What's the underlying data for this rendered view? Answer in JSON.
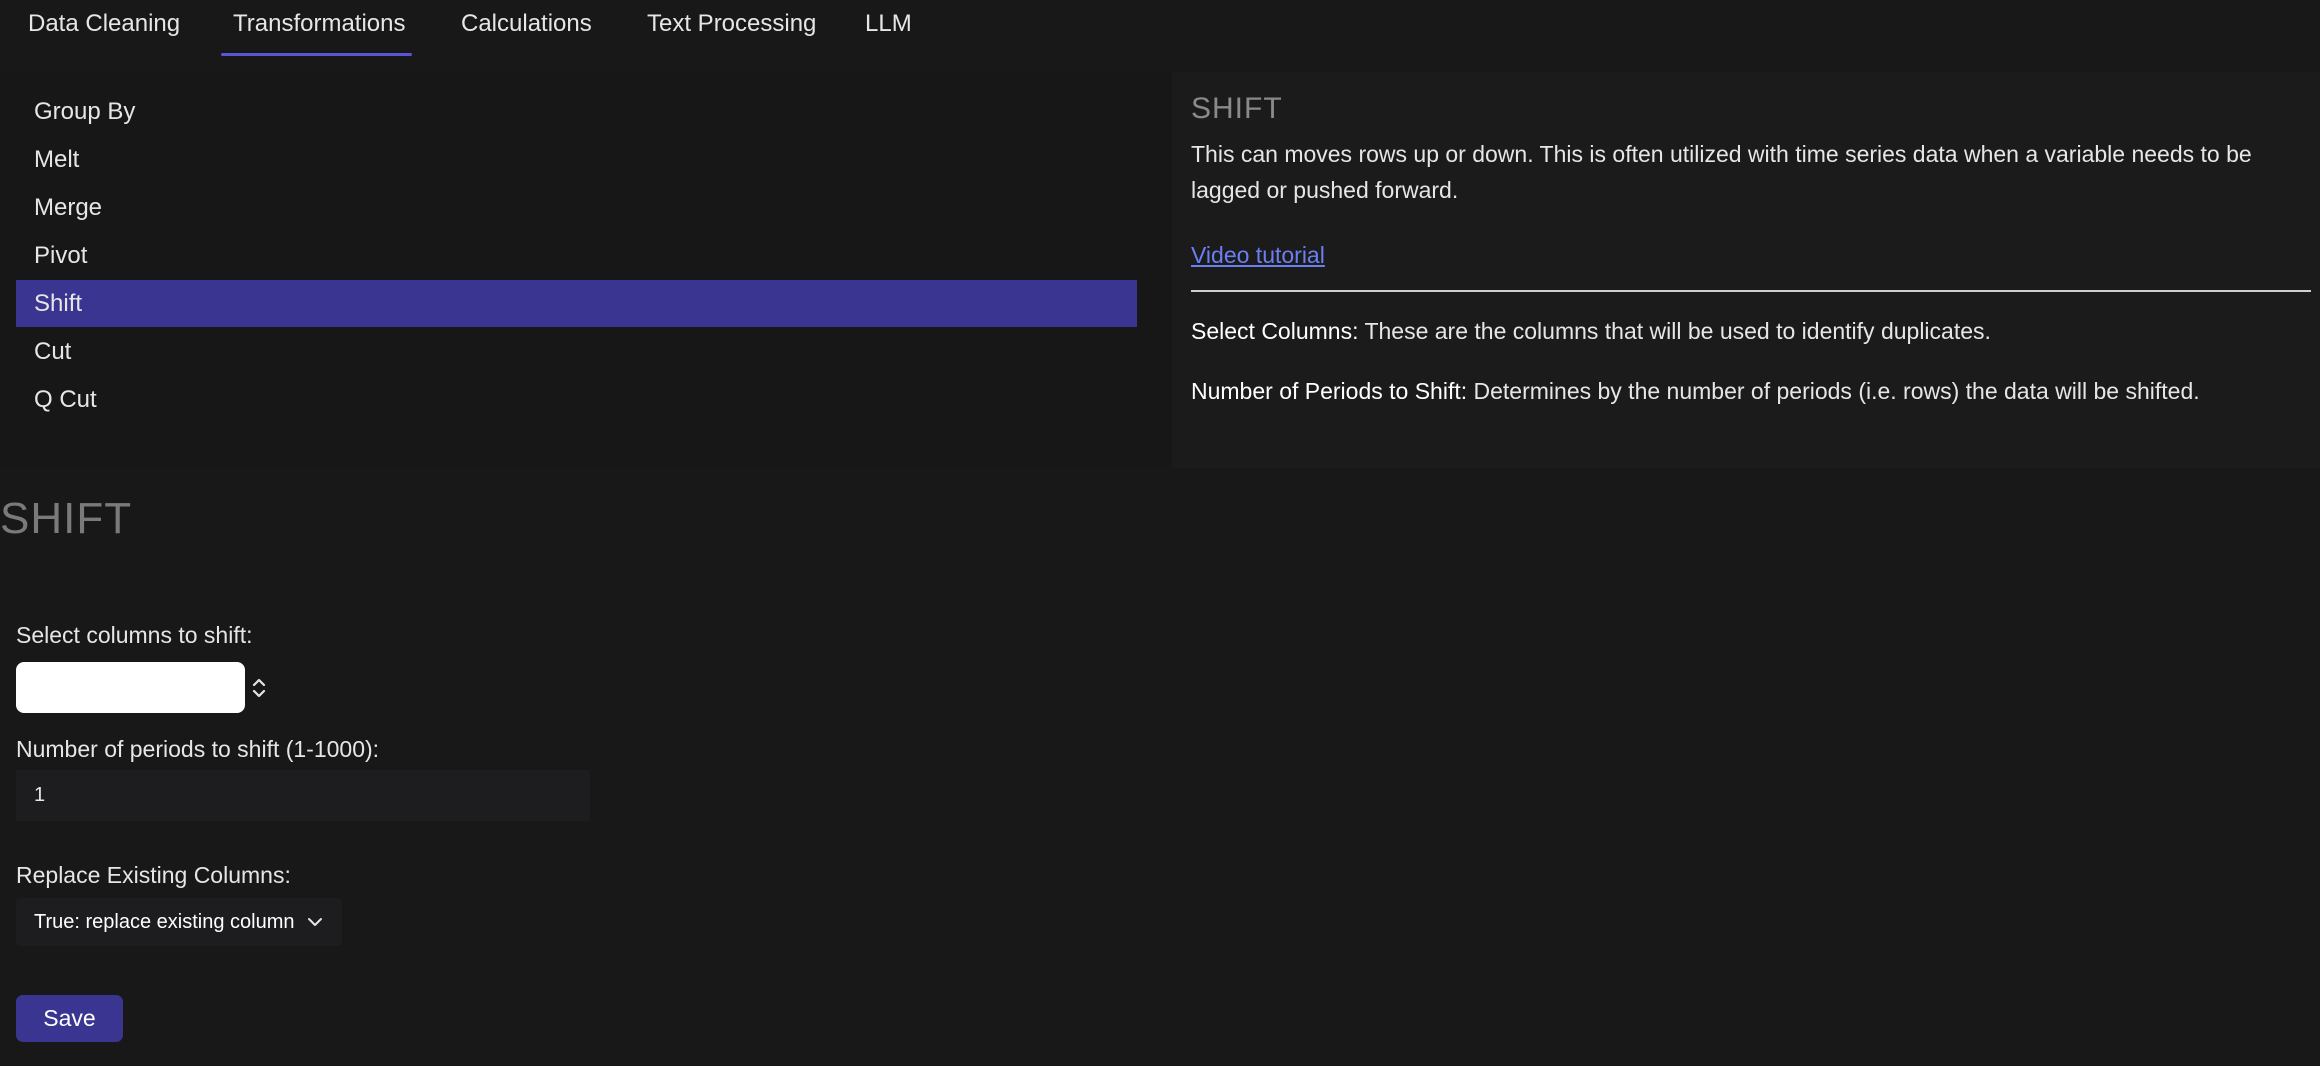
{
  "tabs": [
    {
      "label": "Data Cleaning",
      "active": false
    },
    {
      "label": "Transformations",
      "active": true
    },
    {
      "label": "Calculations",
      "active": false
    },
    {
      "label": "Text Processing",
      "active": false
    },
    {
      "label": "LLM",
      "active": false
    }
  ],
  "operations": [
    {
      "label": "Group By",
      "selected": false
    },
    {
      "label": "Melt",
      "selected": false
    },
    {
      "label": "Merge",
      "selected": false
    },
    {
      "label": "Pivot",
      "selected": false
    },
    {
      "label": "Shift",
      "selected": true
    },
    {
      "label": "Cut",
      "selected": false
    },
    {
      "label": "Q Cut",
      "selected": false
    }
  ],
  "help": {
    "title": "SHIFT",
    "description": "This can moves rows up or down. This is often utilized with time series data when a variable needs to be lagged or pushed forward.",
    "video_link": "Video tutorial",
    "params": [
      {
        "name": "Select Columns:",
        "text": " These are the columns that will be used to identify duplicates."
      },
      {
        "name": "Number of Periods to Shift:",
        "text": " Determines by the number of periods (i.e. rows) the data will be shifted."
      }
    ]
  },
  "form": {
    "section_title": "SHIFT",
    "columns_label": "Select columns to shift:",
    "periods_label": "Number of periods to shift (1-1000):",
    "periods_value": "1",
    "replace_label": "Replace Existing Columns:",
    "replace_value": "True: replace existing column",
    "save_label": "Save"
  },
  "colors": {
    "accent": "#3a3590",
    "tab_underline": "#5a55d6",
    "link": "#6c7ff0",
    "background": "#181818"
  },
  "icons": {
    "select_spinner": "up-down-chevron-icon",
    "dropdown": "chevron-down-icon"
  }
}
